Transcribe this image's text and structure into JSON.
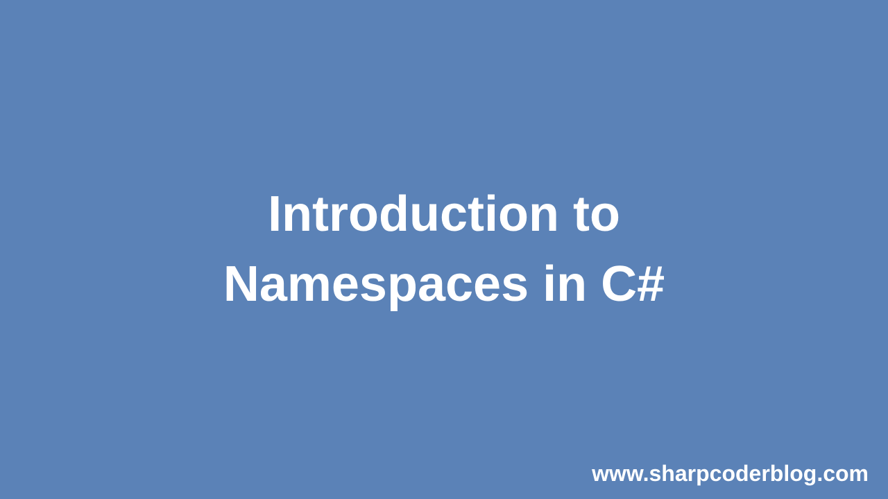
{
  "title": {
    "line1": "Introduction to",
    "line2": "Namespaces in C#"
  },
  "watermark": "www.sharpcoderblog.com",
  "colors": {
    "background": "#5b82b7",
    "text": "#ffffff"
  }
}
